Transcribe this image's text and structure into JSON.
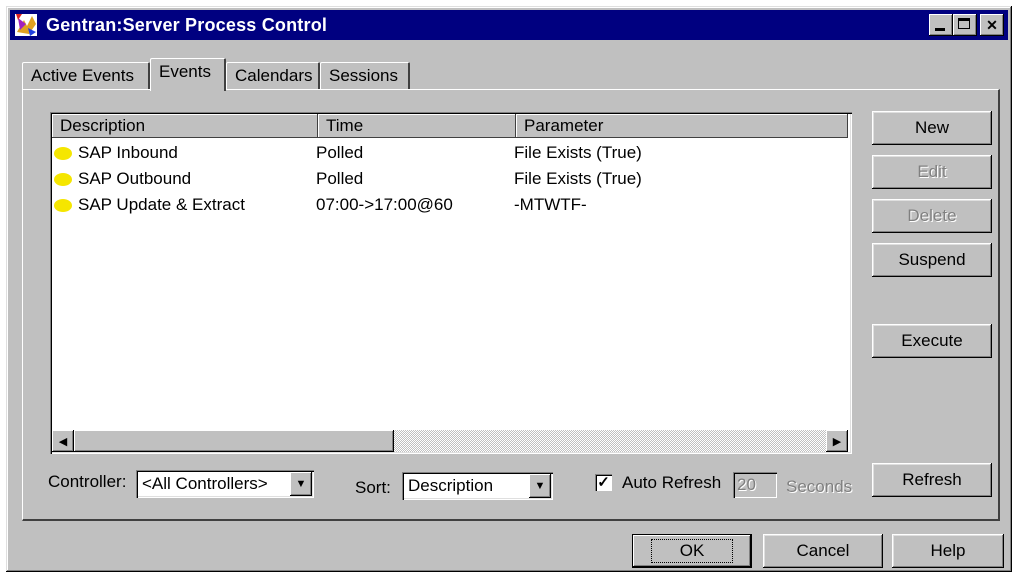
{
  "window": {
    "title": "Gentran:Server Process Control",
    "minimize_icon": "minimize-icon",
    "maximize_icon": "maximize-icon",
    "close_glyph": "✕"
  },
  "tabs": [
    {
      "label": "Active Events"
    },
    {
      "label": "Events"
    },
    {
      "label": "Calendars"
    },
    {
      "label": "Sessions"
    }
  ],
  "list": {
    "columns": [
      "Description",
      "Time",
      "Parameter"
    ],
    "rows": [
      {
        "description": "SAP Inbound",
        "time": "Polled",
        "parameter": "File Exists (True)",
        "status_color": "#f5e600"
      },
      {
        "description": "SAP Outbound",
        "time": "Polled",
        "parameter": "File Exists (True)",
        "status_color": "#f5e600"
      },
      {
        "description": "SAP Update & Extract",
        "time": "07:00->17:00@60",
        "parameter": "-MTWTF-",
        "status_color": "#f5e600"
      }
    ]
  },
  "side_buttons": {
    "new": "New",
    "edit": "Edit",
    "delete": "Delete",
    "suspend": "Suspend",
    "execute": "Execute",
    "refresh": "Refresh"
  },
  "filters": {
    "controller_label": "Controller:",
    "controller_value": "<All Controllers>",
    "sort_label": "Sort:",
    "sort_value": "Description",
    "auto_refresh_label": "Auto Refresh",
    "auto_refresh_checked": true,
    "interval_value": "20",
    "interval_unit": "Seconds"
  },
  "footer": {
    "ok": "OK",
    "cancel": "Cancel",
    "help": "Help"
  }
}
